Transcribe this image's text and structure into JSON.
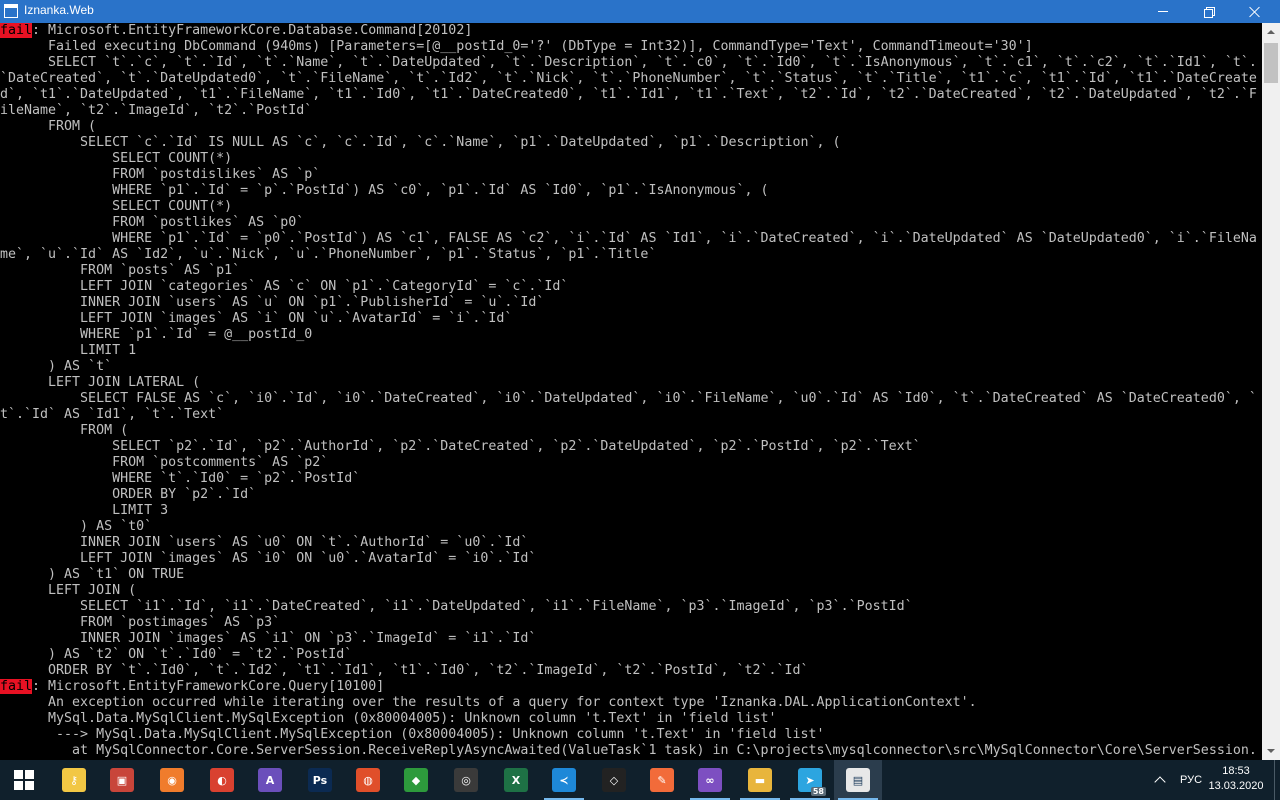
{
  "window": {
    "title": "Iznanka.Web",
    "minimize_glyph": "minimize-icon",
    "maximize_glyph": "restore-icon",
    "close_glyph": "close-icon"
  },
  "console": {
    "level_color": "#e81123",
    "lines": [
      {
        "level": "fail",
        "text": ": Microsoft.EntityFrameworkCore.Database.Command[20102]"
      },
      {
        "text": "      Failed executing DbCommand (940ms) [Parameters=[@__postId_0='?' (DbType = Int32)], CommandType='Text', CommandTimeout='30']"
      },
      {
        "text": "      SELECT `t`.`c`, `t`.`Id`, `t`.`Name`, `t`.`DateUpdated`, `t`.`Description`, `t`.`c0`, `t`.`Id0`, `t`.`IsAnonymous`, `t`.`c1`, `t`.`c2`, `t`.`Id1`, `t`."
      },
      {
        "text": "`DateCreated`, `t`.`DateUpdated0`, `t`.`FileName`, `t`.`Id2`, `t`.`Nick`, `t`.`PhoneNumber`, `t`.`Status`, `t`.`Title`, `t1`.`c`, `t1`.`Id`, `t1`.`DateCreate"
      },
      {
        "text": "d`, `t1`.`DateUpdated`, `t1`.`FileName`, `t1`.`Id0`, `t1`.`DateCreated0`, `t1`.`Id1`, `t1`.`Text`, `t2`.`Id`, `t2`.`DateCreated`, `t2`.`DateUpdated`, `t2`.`F"
      },
      {
        "text": "ileName`, `t2`.`ImageId`, `t2`.`PostId`"
      },
      {
        "text": "      FROM ("
      },
      {
        "text": "          SELECT `c`.`Id` IS NULL AS `c`, `c`.`Id`, `c`.`Name`, `p1`.`DateUpdated`, `p1`.`Description`, ("
      },
      {
        "text": "              SELECT COUNT(*)"
      },
      {
        "text": "              FROM `postdislikes` AS `p`"
      },
      {
        "text": "              WHERE `p1`.`Id` = `p`.`PostId`) AS `c0`, `p1`.`Id` AS `Id0`, `p1`.`IsAnonymous`, ("
      },
      {
        "text": "              SELECT COUNT(*)"
      },
      {
        "text": "              FROM `postlikes` AS `p0`"
      },
      {
        "text": "              WHERE `p1`.`Id` = `p0`.`PostId`) AS `c1`, FALSE AS `c2`, `i`.`Id` AS `Id1`, `i`.`DateCreated`, `i`.`DateUpdated` AS `DateUpdated0`, `i`.`FileNa"
      },
      {
        "text": "me`, `u`.`Id` AS `Id2`, `u`.`Nick`, `u`.`PhoneNumber`, `p1`.`Status`, `p1`.`Title`"
      },
      {
        "text": "          FROM `posts` AS `p1`"
      },
      {
        "text": "          LEFT JOIN `categories` AS `c` ON `p1`.`CategoryId` = `c`.`Id`"
      },
      {
        "text": "          INNER JOIN `users` AS `u` ON `p1`.`PublisherId` = `u`.`Id`"
      },
      {
        "text": "          LEFT JOIN `images` AS `i` ON `u`.`AvatarId` = `i`.`Id`"
      },
      {
        "text": "          WHERE `p1`.`Id` = @__postId_0"
      },
      {
        "text": "          LIMIT 1"
      },
      {
        "text": "      ) AS `t`"
      },
      {
        "text": "      LEFT JOIN LATERAL ("
      },
      {
        "text": "          SELECT FALSE AS `c`, `i0`.`Id`, `i0`.`DateCreated`, `i0`.`DateUpdated`, `i0`.`FileName`, `u0`.`Id` AS `Id0`, `t`.`DateCreated` AS `DateCreated0`, `"
      },
      {
        "text": "t`.`Id` AS `Id1`, `t`.`Text`"
      },
      {
        "text": "          FROM ("
      },
      {
        "text": "              SELECT `p2`.`Id`, `p2`.`AuthorId`, `p2`.`DateCreated`, `p2`.`DateUpdated`, `p2`.`PostId`, `p2`.`Text`"
      },
      {
        "text": "              FROM `postcomments` AS `p2`"
      },
      {
        "text": "              WHERE `t`.`Id0` = `p2`.`PostId`"
      },
      {
        "text": "              ORDER BY `p2`.`Id`"
      },
      {
        "text": "              LIMIT 3"
      },
      {
        "text": "          ) AS `t0`"
      },
      {
        "text": "          INNER JOIN `users` AS `u0` ON `t`.`AuthorId` = `u0`.`Id`"
      },
      {
        "text": "          LEFT JOIN `images` AS `i0` ON `u0`.`AvatarId` = `i0`.`Id`"
      },
      {
        "text": "      ) AS `t1` ON TRUE"
      },
      {
        "text": "      LEFT JOIN ("
      },
      {
        "text": "          SELECT `i1`.`Id`, `i1`.`DateCreated`, `i1`.`DateUpdated`, `i1`.`FileName`, `p3`.`ImageId`, `p3`.`PostId`"
      },
      {
        "text": "          FROM `postimages` AS `p3`"
      },
      {
        "text": "          INNER JOIN `images` AS `i1` ON `p3`.`ImageId` = `i1`.`Id`"
      },
      {
        "text": "      ) AS `t2` ON `t`.`Id0` = `t2`.`PostId`"
      },
      {
        "text": "      ORDER BY `t`.`Id0`, `t`.`Id2`, `t1`.`Id1`, `t1`.`Id0`, `t2`.`ImageId`, `t2`.`PostId`, `t2`.`Id`"
      },
      {
        "level": "fail",
        "text": ": Microsoft.EntityFrameworkCore.Query[10100]"
      },
      {
        "text": "      An exception occurred while iterating over the results of a query for context type 'Iznanka.DAL.ApplicationContext'."
      },
      {
        "text": "      MySql.Data.MySqlClient.MySqlException (0x80004005): Unknown column 't.Text' in 'field list'"
      },
      {
        "text": "       ---> MySql.Data.MySqlClient.MySqlException (0x80004005): Unknown column 't.Text' in 'field list'"
      },
      {
        "text": "         at MySqlConnector.Core.ServerSession.ReceiveReplyAsyncAwaited(ValueTask`1 task) in C:\\projects\\mysqlconnector\\src\\MySqlConnector\\Core\\ServerSession."
      }
    ]
  },
  "taskbar": {
    "apps": [
      {
        "name": "start-button",
        "icon": "windows-logo-icon"
      },
      {
        "name": "taskbar-app-keepass",
        "icon": "key-icon",
        "color": "#f2c744",
        "glyph": "⚷"
      },
      {
        "name": "taskbar-app-remote-desktop",
        "icon": "remote-desktop-icon",
        "color": "#c8453a",
        "glyph": "▣"
      },
      {
        "name": "taskbar-app-orange-tool",
        "icon": "orange-square-icon",
        "color": "#f07c2c",
        "glyph": "◉"
      },
      {
        "name": "taskbar-app-chrome-like",
        "icon": "swirl-icon",
        "color": "#d94130",
        "glyph": "◐"
      },
      {
        "name": "taskbar-app-affinity",
        "icon": "triangle-a-icon",
        "color": "#6b4fbb",
        "glyph": "A"
      },
      {
        "name": "taskbar-app-photoshop",
        "icon": "photoshop-icon",
        "color": "#0b2a52",
        "glyph": "Ps"
      },
      {
        "name": "taskbar-app-opera-like",
        "icon": "circle-logo-icon",
        "color": "#e04f2a",
        "glyph": "◍"
      },
      {
        "name": "taskbar-app-git",
        "icon": "green-diamond-icon",
        "color": "#2d9a3c",
        "glyph": "◆"
      },
      {
        "name": "taskbar-app-obs",
        "icon": "record-icon",
        "color": "#3a3a3a",
        "glyph": "◎"
      },
      {
        "name": "taskbar-app-excel",
        "icon": "excel-icon",
        "color": "#1e7145",
        "glyph": "X"
      },
      {
        "name": "taskbar-app-vscode",
        "icon": "vscode-icon",
        "color": "#1e88d8",
        "glyph": "≺"
      },
      {
        "name": "taskbar-app-unity",
        "icon": "unity-icon",
        "color": "#222222",
        "glyph": "◇"
      },
      {
        "name": "taskbar-app-postman",
        "icon": "postman-icon",
        "color": "#f26b3a",
        "glyph": "✎"
      },
      {
        "name": "taskbar-app-visual-studio",
        "icon": "visual-studio-icon",
        "color": "#7d4fc1",
        "glyph": "∞"
      },
      {
        "name": "taskbar-app-file-explorer",
        "icon": "folder-icon",
        "color": "#e8b53c",
        "glyph": "▬"
      },
      {
        "name": "taskbar-app-telegram",
        "icon": "telegram-icon",
        "color": "#2ca5e0",
        "glyph": "➤",
        "badge": "58"
      },
      {
        "name": "taskbar-app-console",
        "icon": "console-window-icon",
        "color": "#e8e8e8",
        "glyph": "▤"
      }
    ],
    "language": "РУС",
    "time": "18:53",
    "date": "13.03.2020"
  }
}
